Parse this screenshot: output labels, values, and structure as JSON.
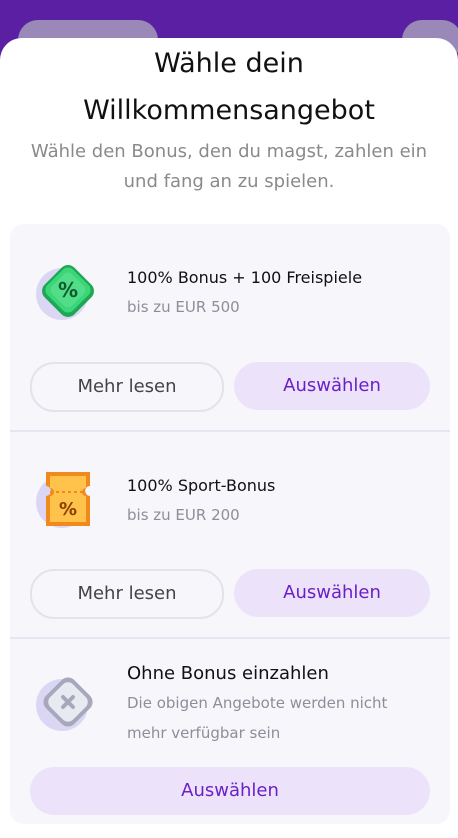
{
  "header": {
    "title_line1": "Wähle dein",
    "title_line2": "Willkommensangebot",
    "subtitle": "Wähle den Bonus, den du magst, zahlen ein und fang an zu spielen."
  },
  "offers": [
    {
      "icon": "percent-diamond-icon",
      "title": "100% Bonus + 100 Freispiele",
      "subtitle": "bis zu EUR 500",
      "more_label": "Mehr lesen",
      "select_label": "Auswählen"
    },
    {
      "icon": "percent-ticket-icon",
      "title": "100% Sport-Bonus",
      "subtitle": "bis zu EUR 200",
      "more_label": "Mehr lesen",
      "select_label": "Auswählen"
    },
    {
      "icon": "no-bonus-x-icon",
      "title": "Ohne Bonus einzahlen",
      "subtitle_line1": "Die obigen Angebote werden nicht",
      "subtitle_line2": "mehr verfügbar sein",
      "select_label": "Auswählen"
    }
  ],
  "colors": {
    "accent": "#6c1fc7",
    "accent_bg": "#ece3fa",
    "backdrop": "#5a1fa3",
    "green": "#2fc36b",
    "orange": "#f08a1c"
  }
}
